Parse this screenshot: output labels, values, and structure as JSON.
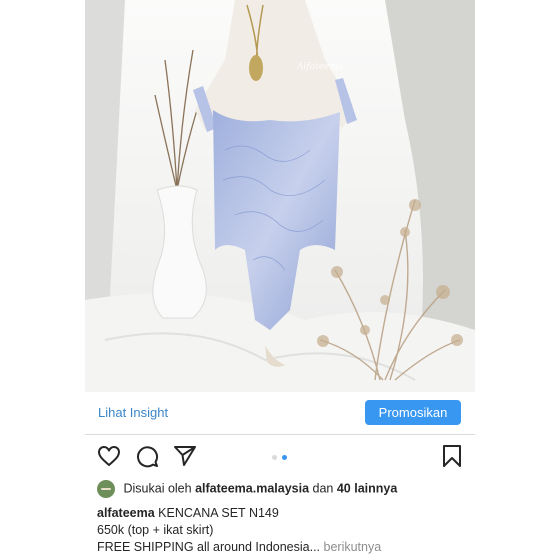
{
  "post": {
    "watermark": "Alfateema"
  },
  "insight_bar": {
    "insight_label": "Lihat Insight",
    "promote_label": "Promosikan"
  },
  "carousel": {
    "active_index": 2,
    "total": 2,
    "active_color": "#3897f0",
    "inactive_color": "#dbdbdb"
  },
  "actions": {
    "icons": [
      "heart-icon",
      "comment-icon",
      "share-icon",
      "bookmark-icon"
    ]
  },
  "likes": {
    "prefix": "Disukai oleh",
    "user": "alfateema.malaysia",
    "connector": "dan",
    "others": "40 lainnya"
  },
  "caption": {
    "username": "alfateema",
    "line1": "KENCANA SET N149",
    "line2": "650k (top + ikat skirt)",
    "line3": "FREE SHIPPING all around Indonesia...",
    "more": "berikutnya"
  },
  "colors": {
    "accent": "#3897f0",
    "link": "#3b86c9",
    "text": "#262626",
    "muted": "#8e8e8e"
  }
}
